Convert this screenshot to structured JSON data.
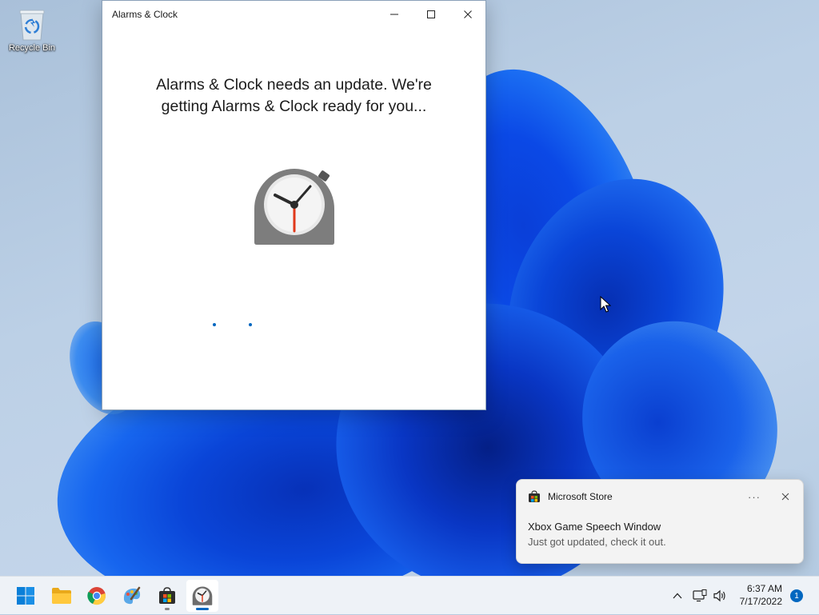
{
  "desktop": {
    "icons": [
      {
        "label": "Recycle Bin",
        "icon": "recycle-bin-icon"
      }
    ]
  },
  "window": {
    "title": "Alarms & Clock",
    "controls": {
      "minimize": "minimize-icon",
      "maximize": "maximize-icon",
      "close": "close-icon"
    },
    "message_line1": "Alarms & Clock needs an update. We're",
    "message_line2": "getting Alarms & Clock ready for you...",
    "logo": "alarms-clock-app-icon",
    "loading": "progress-dots"
  },
  "toast": {
    "app_name": "Microsoft Store",
    "app_icon": "microsoft-store-icon",
    "more": "···",
    "title": "Xbox Game Speech Window",
    "body": "Just got updated, check it out."
  },
  "taskbar": {
    "items": [
      {
        "name": "start",
        "icon": "windows-start-icon"
      },
      {
        "name": "file-explorer",
        "icon": "folder-icon"
      },
      {
        "name": "chrome",
        "icon": "chrome-icon"
      },
      {
        "name": "photos",
        "icon": "paint-icon"
      },
      {
        "name": "microsoft-store",
        "icon": "store-bag-icon"
      },
      {
        "name": "alarms-clock",
        "icon": "alarms-clock-icon",
        "active": true
      }
    ],
    "tray": {
      "overflow": "chevron-up-icon",
      "network": "network-icon",
      "volume": "volume-icon",
      "time": "6:37 AM",
      "date": "7/17/2022",
      "notifications": "1"
    }
  },
  "colors": {
    "accent": "#0067c0",
    "clock_hand_red": "#e0391a",
    "clock_body": "#7a7a7a",
    "taskbar_bg": "#eef2f7",
    "toast_bg": "#f3f3f3"
  }
}
